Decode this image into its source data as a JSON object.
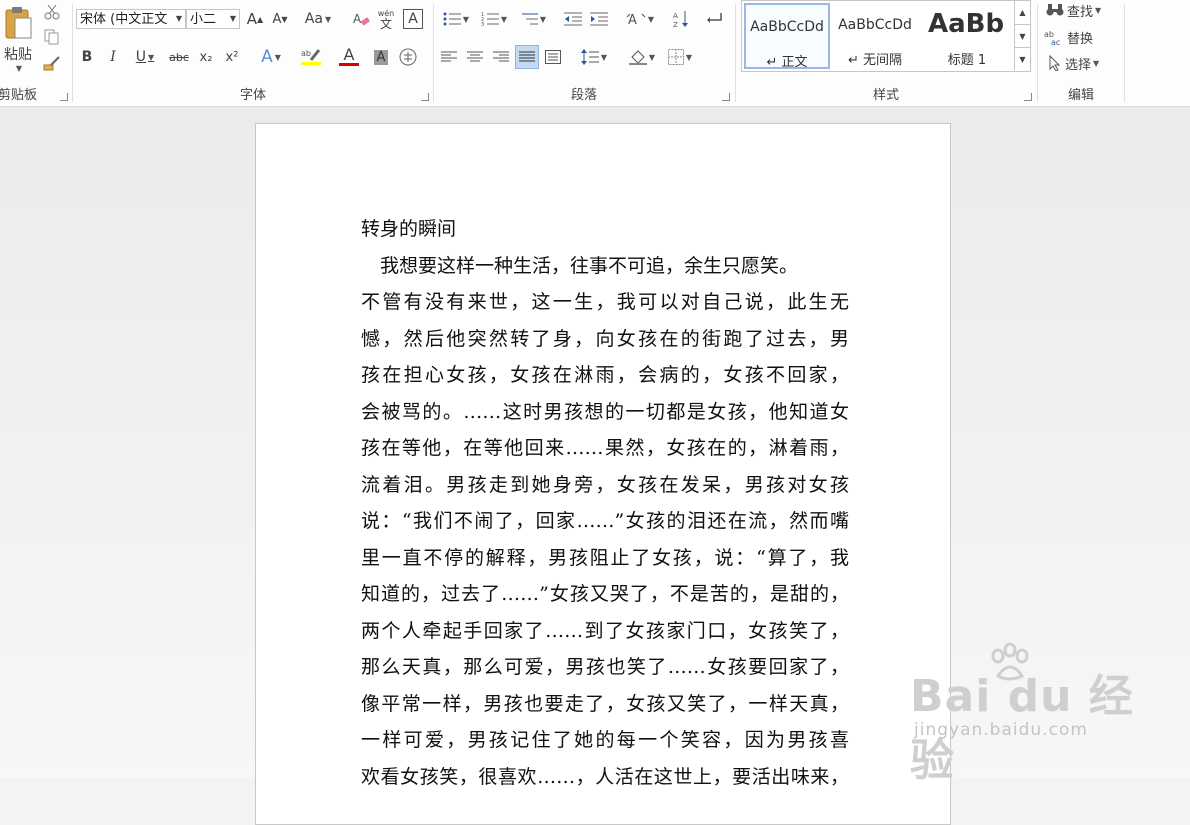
{
  "ribbon": {
    "clipboard": {
      "paste_label": "粘贴",
      "group_label": "剪贴板"
    },
    "font": {
      "font_name": "宋体 (中文正文",
      "font_size": "小二",
      "bold": "B",
      "italic": "I",
      "underline": "U",
      "strikethrough": "abc",
      "subscript": "x₂",
      "superscript": "x²",
      "change_case": "Aa",
      "grow_font": "A",
      "shrink_font": "A",
      "text_effects": "A",
      "font_color": "A",
      "char_shading": "A",
      "enclose": "字",
      "phonetic_top": "wén",
      "phonetic_bottom": "文",
      "char_border": "A",
      "group_label": "字体"
    },
    "paragraph": {
      "group_label": "段落"
    },
    "styles": {
      "items": [
        {
          "preview": "AaBbCcDd",
          "name": "↵ 正文"
        },
        {
          "preview": "AaBbCcDd",
          "name": "↵ 无间隔"
        },
        {
          "preview": "AaBb",
          "name": "标题 1"
        }
      ],
      "group_label": "样式"
    },
    "editing": {
      "find": "查找",
      "replace": "替换",
      "select": "选择",
      "group_label": "编辑"
    }
  },
  "document": {
    "lines": [
      "转身的瞬间",
      "　我想要这样一种生活，往事不可追，余生只愿笑。",
      "不管有没有来世，这一生，我可以对自己说，此生无",
      "憾，然后他突然转了身，向女孩在的街跑了过去，男",
      "孩在担心女孩，女孩在淋雨，会病的，女孩不回家，",
      "会被骂的。……这时男孩想的一切都是女孩，他知道女",
      "孩在等他，在等他回来……果然，女孩在的，淋着雨，",
      "流着泪。男孩走到她身旁，女孩在发呆，男孩对女孩",
      "说：“我们不闹了，回家……”女孩的泪还在流，然而嘴",
      "里一直不停的解释，男孩阻止了女孩，说：“算了，我",
      "知道的，过去了……”女孩又哭了，不是苦的，是甜的，",
      "两个人牵起手回家了……到了女孩家门口，女孩笑了，",
      "那么天真，那么可爱，男孩也笑了……女孩要回家了，",
      "像平常一样，男孩也要走了，女孩又笑了，一样天真，",
      "一样可爱，男孩记住了她的每一个笑容，因为男孩喜",
      "欢看女孩笑，很喜欢……，人活在这世上，要活出味来，"
    ]
  },
  "watermark": {
    "brand": "Bai du 经验",
    "url": "jingyan.baidu.com"
  },
  "colors": {
    "highlight": "#ffff00",
    "font_color": "#e00000",
    "accent": "#2b579a"
  }
}
